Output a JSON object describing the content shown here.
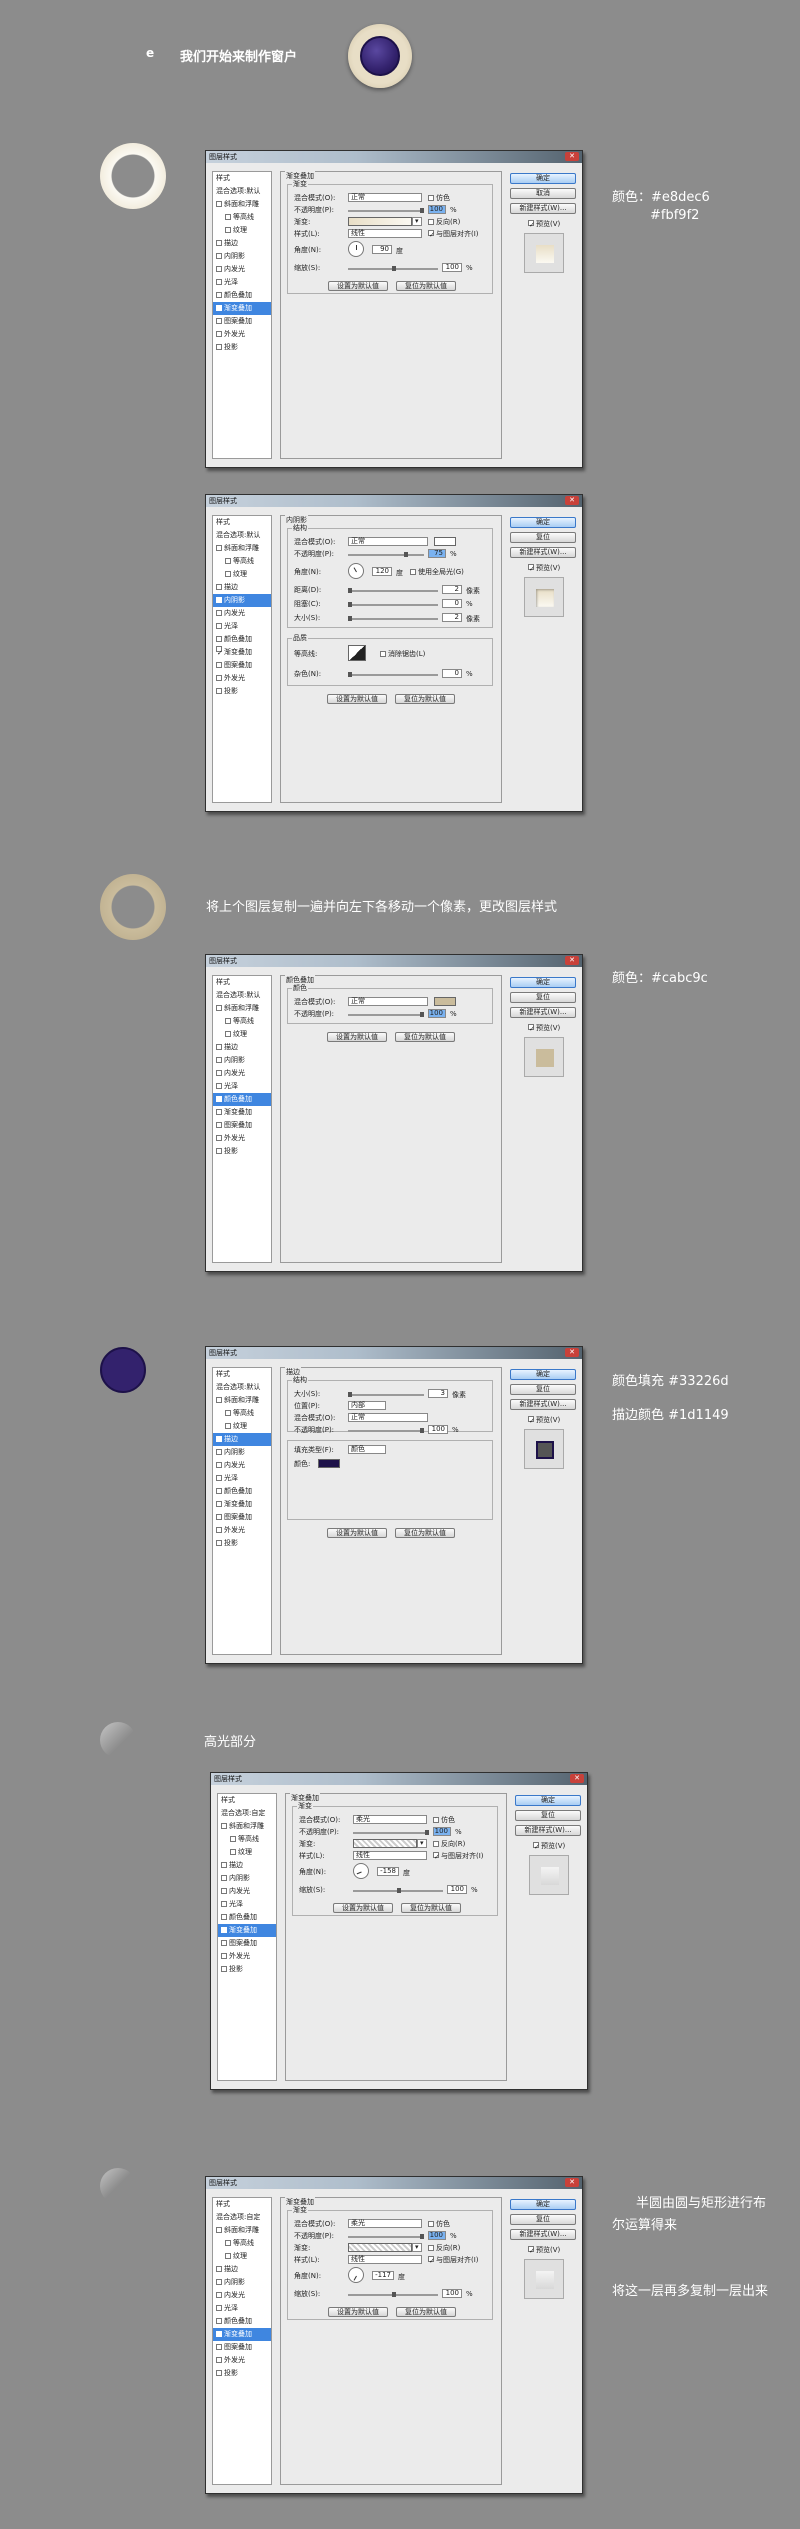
{
  "header": {
    "letter": "e",
    "title": "我们开始来制作窗户"
  },
  "notes": {
    "n1a": "颜色：#e8dec6",
    "n1b": "#fbf9f2",
    "n3": "将上个图层复制一遍并向左下各移动一个像素，更改图层样式",
    "n3c": "颜色：#cabc9c",
    "n4a": "颜色填充 #33226d",
    "n4b": "描边颜色 #1d1149",
    "n5": "高光部分",
    "n6a": "半圆由圆与矩形进行布",
    "n6b": "尔运算得来",
    "n6c": "将这一层再多复制一层出来"
  },
  "colors": {
    "ring_light": "#e8dec6",
    "ring_light2": "#fbf9f2",
    "ring_dark": "#cabc9c",
    "fill": "#33226d",
    "stroke": "#1d1149",
    "accent": "#3f86e0"
  },
  "dialog": {
    "title": "图层样式",
    "style_header": "样式",
    "blend_default": "混合选项:默认",
    "blend_custom": "混合选项:自定",
    "items": {
      "bevel": "斜面和浮雕",
      "contour": "等高线",
      "texture": "纹理",
      "stroke": "描边",
      "inner_shadow": "内阴影",
      "inner_glow": "内发光",
      "satin": "光泽",
      "color_overlay": "颜色叠加",
      "gradient_overlay": "渐变叠加",
      "pattern_overlay": "图案叠加",
      "outer_glow": "外发光",
      "drop_shadow": "投影"
    },
    "buttons": {
      "ok": "确定",
      "cancel": "取消",
      "reset": "复位",
      "new_style": "新建样式(W)...",
      "preview": "预览(V)",
      "set_default": "设置为默认值",
      "reset_default": "复位为默认值"
    },
    "labels": {
      "gradient_overlay": "渐变叠加",
      "gradient": "渐变",
      "blend_mode": "混合模式(O):",
      "opacity": "不透明度(P):",
      "grad": "渐变:",
      "style": "样式(L):",
      "angle": "角度(N):",
      "scale": "缩放(S):",
      "dither": "仿色",
      "reverse": "反向(R)",
      "align": "与图层对齐(I)",
      "normal": "正常",
      "linear": "线性",
      "degree": "度",
      "pct": "%",
      "pixel": "像素",
      "inner_shadow": "内阴影",
      "structure": "结构",
      "use_global": "使用全局光(G)",
      "distance": "距离(D):",
      "choke": "阻塞(C):",
      "size": "大小(S):",
      "quality": "品质",
      "contour": "等高线:",
      "anti_alias": "消除锯齿(L)",
      "noise": "杂色(N):",
      "color_overlay": "颜色叠加",
      "color": "颜色",
      "stroke": "描边",
      "size2": "大小(S):",
      "position": "位置(P):",
      "inside": "内部",
      "fill_type": "填充类型(F):",
      "fill_color": "颜色",
      "color_label": "颜色:",
      "overlay": "柔光",
      "opacity_v": "100",
      "opacity_v2": "100",
      "opacity_75": "75",
      "angle_90": "90",
      "angle_120": "120",
      "angle_n158": "-158",
      "angle_n117": "-117",
      "scale_v": "100",
      "v2": "2",
      "v0": "0",
      "v3": "3"
    }
  }
}
